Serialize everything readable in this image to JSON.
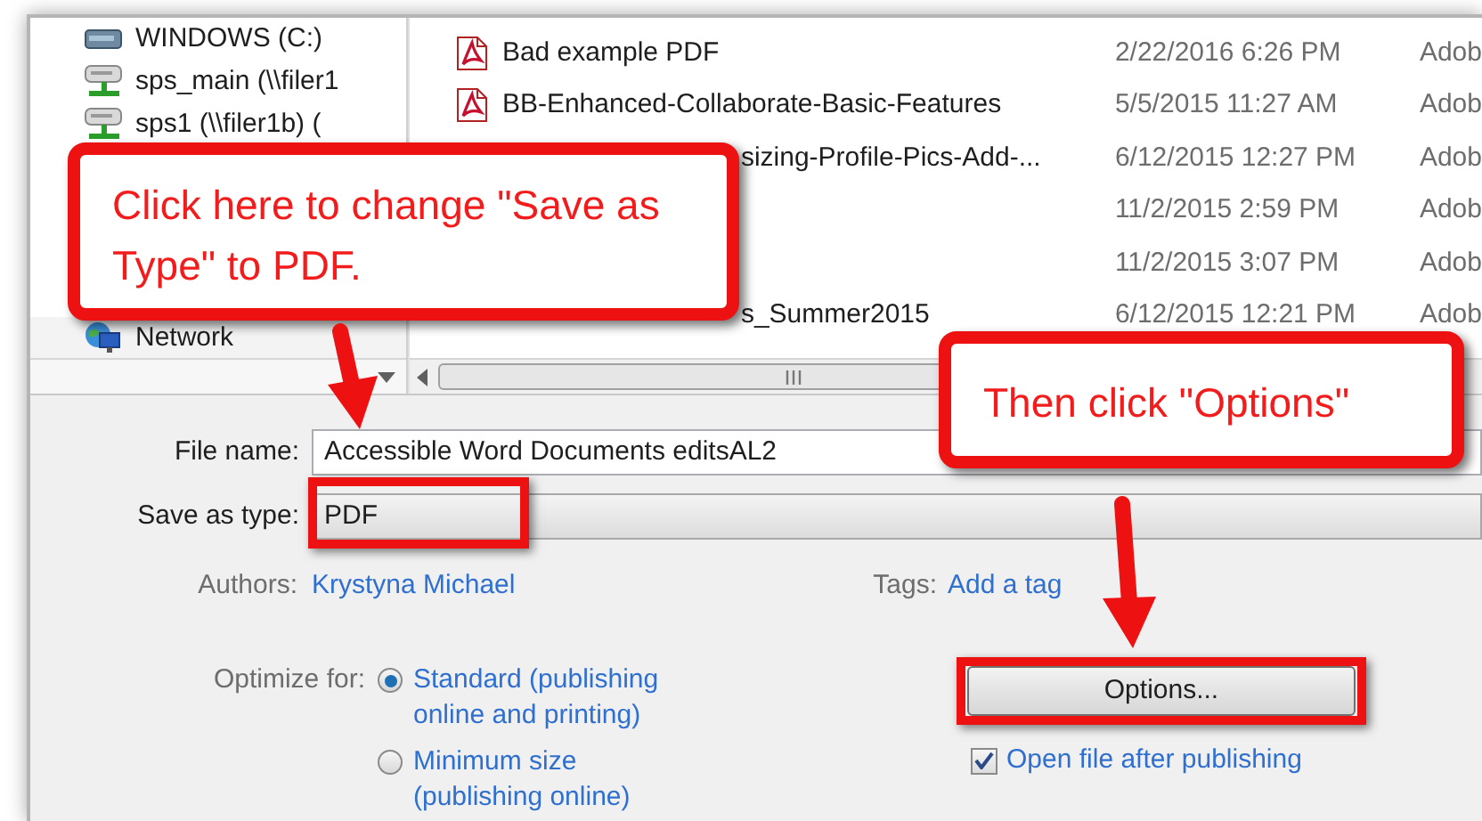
{
  "navigation_pane": {
    "items": [
      {
        "label": "WINDOWS (C:)",
        "kind": "drive"
      },
      {
        "label": "sps_main (\\\\filer1",
        "kind": "network-drive"
      },
      {
        "label": "sps1 (\\\\filer1b) (",
        "kind": "network-drive"
      },
      {
        "label": "Network",
        "kind": "network"
      }
    ]
  },
  "file_list": {
    "rows": [
      {
        "kind": "pdf",
        "name": "Bad example PDF",
        "date": "2/22/2016 6:26 PM",
        "type": "Adob"
      },
      {
        "kind": "pdf",
        "name": "BB-Enhanced-Collaborate-Basic-Features",
        "date": "5/5/2015 11:27 AM",
        "type": "Adob"
      },
      {
        "kind": "covered",
        "name": "sizing-Profile-Pics-Add-...",
        "date": "6/12/2015 12:27 PM",
        "type": "Adob"
      },
      {
        "kind": "covered",
        "date": "11/2/2015 2:59 PM",
        "type": "Adob"
      },
      {
        "kind": "covered",
        "date": "11/2/2015 3:07 PM",
        "type": "Adob"
      },
      {
        "kind": "covered",
        "name": "s_Summer2015",
        "date": "6/12/2015 12:21 PM",
        "type": "Adob"
      }
    ]
  },
  "form": {
    "file_name": {
      "label": "File name:",
      "value": "Accessible Word Documents editsAL2"
    },
    "save_as_type": {
      "label": "Save as type:",
      "value": "PDF"
    },
    "authors": {
      "label": "Authors:",
      "value": "Krystyna Michael"
    },
    "tags": {
      "label": "Tags:",
      "value": "Add a tag"
    },
    "optimize_for": {
      "label": "Optimize for:",
      "options": [
        {
          "label": "Standard (publishing online and printing)",
          "selected": true
        },
        {
          "label": "Minimum size (publishing online)",
          "selected": false
        }
      ]
    },
    "options_button": "Options...",
    "open_after_publishing": {
      "label": "Open file after publishing",
      "checked": true
    }
  },
  "annotations": [
    {
      "text": "Click here to change \"Save as Type\" to PDF."
    },
    {
      "text": "Then click \"Options\""
    }
  ]
}
